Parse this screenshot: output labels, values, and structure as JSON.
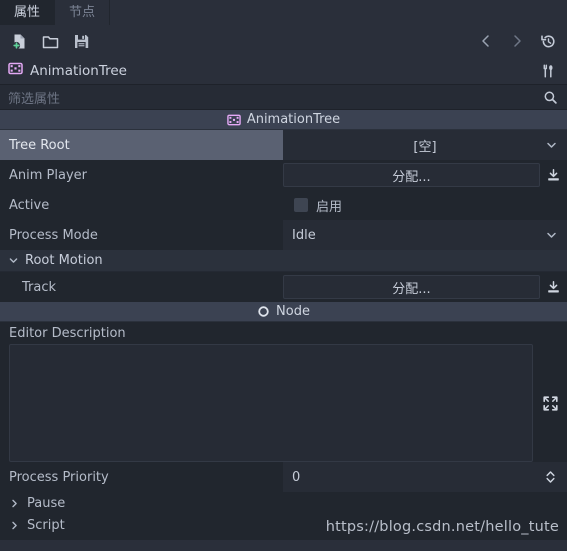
{
  "tabs": [
    {
      "label": "属性",
      "name": "tab-properties",
      "active": true
    },
    {
      "label": "节点",
      "name": "tab-node",
      "active": false
    }
  ],
  "toolbar": {
    "new_icon": "new-file-icon",
    "open_icon": "open-folder-icon",
    "save_icon": "save-icon",
    "back_icon": "chevron-left-icon",
    "forward_icon": "chevron-right-icon",
    "history_icon": "history-icon"
  },
  "object_header": {
    "title": "AnimationTree",
    "icon": "animation-tree-icon",
    "tools_icon": "object-tools-icon"
  },
  "filter": {
    "placeholder": "筛选属性",
    "value": "",
    "search_icon": "search-icon"
  },
  "categories": {
    "animation_tree": {
      "label": "AnimationTree",
      "icon": "animation-tree-icon"
    },
    "node": {
      "label": "Node",
      "icon": "node-circle-icon"
    }
  },
  "properties": {
    "tree_root": {
      "label": "Tree Root",
      "value": "[空]",
      "selected": true,
      "caret_icon": "chevron-down-icon"
    },
    "anim_player": {
      "label": "Anim Player",
      "value": "分配...",
      "side_icon": "load-icon"
    },
    "active": {
      "label": "Active",
      "checkbox_label": "启用",
      "checked": false
    },
    "process_mode": {
      "label": "Process Mode",
      "value": "Idle",
      "caret_icon": "chevron-down-icon"
    },
    "root_motion": {
      "label": "Root Motion",
      "expanded": true,
      "arrow_icon": "chevron-down-icon"
    },
    "track": {
      "label": "Track",
      "value": "分配...",
      "side_icon": "load-icon"
    },
    "editor_description": {
      "label": "Editor Description",
      "value": "",
      "expand_icon": "expand-icon"
    },
    "process_priority": {
      "label": "Process Priority",
      "value": "0",
      "spin_icon": "updown-spinner-icon"
    }
  },
  "foldouts": [
    {
      "label": "Pause",
      "arrow_icon": "chevron-right-icon",
      "name": "foldout-pause"
    },
    {
      "label": "Script",
      "arrow_icon": "chevron-right-icon",
      "name": "foldout-script"
    }
  ],
  "watermark": {
    "text": "https://blog.csdn.net/hello_tute"
  },
  "colors": {
    "bg": "#21262e",
    "panel": "#2a2f3a",
    "category": "#3b4252",
    "selection": "#5a6172",
    "field": "#272c36",
    "text": "#c3c9d4",
    "accent_icon": "#e4a9f5"
  }
}
